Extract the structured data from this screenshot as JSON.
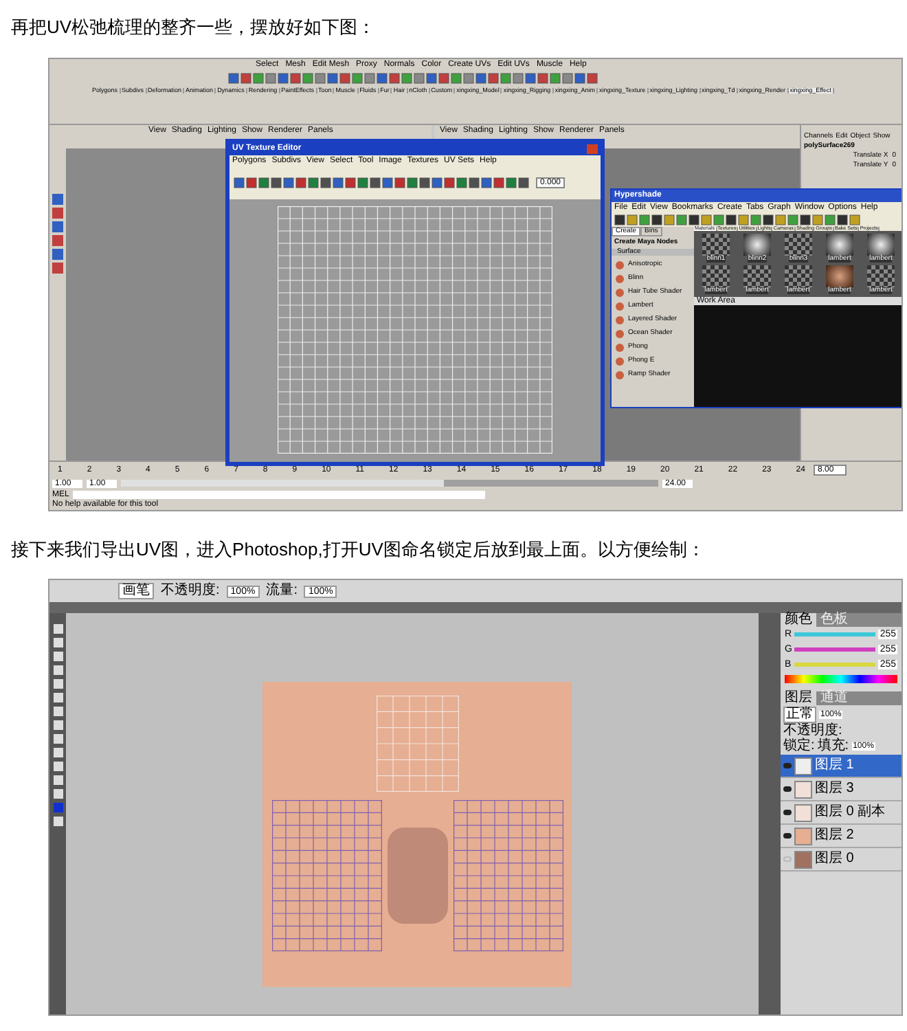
{
  "intro_text": "再把UV松弛梳理的整齐一些，摆放好如下图：",
  "maya_screenshot": {
    "menus": [
      "Select",
      "Mesh",
      "Edit Mesh",
      "Proxy",
      "Normals",
      "Color",
      "Create UVs",
      "Edit UVs",
      "Muscle",
      "Help"
    ],
    "shelf_tabs": [
      {
        "label": "Polygons",
        "selected": false
      },
      {
        "label": "Subdivs",
        "selected": false
      },
      {
        "label": "Deformation",
        "selected": false
      },
      {
        "label": "Animation",
        "selected": false
      },
      {
        "label": "Dynamics",
        "selected": false
      },
      {
        "label": "Rendering",
        "selected": false
      },
      {
        "label": "PaintEffects",
        "selected": false
      },
      {
        "label": "Toon",
        "selected": false
      },
      {
        "label": "Muscle",
        "selected": false
      },
      {
        "label": "Fluids",
        "selected": false
      },
      {
        "label": "Fur",
        "selected": false
      },
      {
        "label": "Hair",
        "selected": false
      },
      {
        "label": "nCloth",
        "selected": false
      },
      {
        "label": "Custom",
        "selected": false
      },
      {
        "label": "xingxing_Model",
        "selected": false
      },
      {
        "label": "xingxing_Rigging",
        "selected": false
      },
      {
        "label": "xingxing_Anim",
        "selected": false
      },
      {
        "label": "xingxing_Texture",
        "selected": false
      },
      {
        "label": "xingxing_Lighting",
        "selected": false
      },
      {
        "label": "xingxing_Td",
        "selected": false
      },
      {
        "label": "xingxing_Render",
        "selected": false
      },
      {
        "label": "xingxing_Effect",
        "selected": true
      }
    ],
    "viewports": [
      {
        "menus": [
          "View",
          "Shading",
          "Lighting",
          "Show",
          "Renderer",
          "Panels"
        ]
      },
      {
        "menus": [
          "View",
          "Shading",
          "Lighting",
          "Show",
          "Renderer",
          "Panels"
        ]
      }
    ],
    "channel_box": {
      "menus": [
        "Channels",
        "Edit",
        "Object",
        "Show"
      ],
      "object": "polySurface269",
      "attributes": [
        {
          "name": "Translate X",
          "value": "0"
        },
        {
          "name": "Translate Y",
          "value": "0"
        }
      ]
    },
    "uv_editor": {
      "title": "UV Texture Editor",
      "menus": [
        "Polygons",
        "Subdivs",
        "View",
        "Select",
        "Tool",
        "Image",
        "Textures",
        "UV Sets",
        "Help"
      ],
      "field_value": "0.000"
    },
    "hypershade": {
      "title": "Hypershade",
      "menus": [
        "File",
        "Edit",
        "View",
        "Bookmarks",
        "Create",
        "Tabs",
        "Graph",
        "Window",
        "Options",
        "Help"
      ],
      "side_tabs": [
        {
          "label": "Create",
          "selected": true
        },
        {
          "label": "Bins",
          "selected": false
        }
      ],
      "nodes_heading": "Create Maya Nodes",
      "group": "Surface",
      "nodes": [
        "Anisotropic",
        "Blinn",
        "Hair Tube Shader",
        "Lambert",
        "Layered Shader",
        "Ocean Shader",
        "Phong",
        "Phong E",
        "Ramp Shader"
      ],
      "tabs": [
        {
          "label": "Materials",
          "selected": true
        },
        {
          "label": "Textures",
          "selected": false
        },
        {
          "label": "Utilities",
          "selected": false
        },
        {
          "label": "Lights",
          "selected": false
        },
        {
          "label": "Cameras",
          "selected": false
        },
        {
          "label": "Shading Groups",
          "selected": false
        },
        {
          "label": "Bake Sets",
          "selected": false
        },
        {
          "label": "Projects",
          "selected": false
        }
      ],
      "swatches": [
        {
          "label": "blinn1",
          "kind": "checker"
        },
        {
          "label": "blinn2",
          "kind": "sphere"
        },
        {
          "label": "blinn3",
          "kind": "checker"
        },
        {
          "label": "lambert",
          "kind": "sphere"
        },
        {
          "label": "lambert",
          "kind": "sphere"
        },
        {
          "label": "lambert",
          "kind": "checker"
        },
        {
          "label": "lambert",
          "kind": "checker"
        },
        {
          "label": "lambert",
          "kind": "checker"
        },
        {
          "label": "lambert",
          "kind": "skin"
        },
        {
          "label": "lambert",
          "kind": "checker"
        }
      ],
      "work_area": "Work Area"
    },
    "timeline": [
      "1",
      "2",
      "3",
      "4",
      "5",
      "6",
      "7",
      "8",
      "9",
      "10",
      "11",
      "12",
      "13",
      "14",
      "15",
      "16",
      "17",
      "18",
      "19",
      "20",
      "21",
      "22",
      "23",
      "24"
    ],
    "current_time": "8.00",
    "range": {
      "level": 0.6
    },
    "range_start": "1.00",
    "range_current": "1.00",
    "range_end": "24.00",
    "command_label": "MEL",
    "help_line": "No help available for this tool"
  },
  "export_text": "接下来我们导出UV图，进入Photoshop,打开UV图命名锁定后放到最上面。以方便绘制：",
  "photoshop_screenshot": {
    "options": {
      "tool": "画笔",
      "opacity_label": "不透明度:",
      "opacity": "100%",
      "flow_label": "流量:",
      "flow": "100%"
    },
    "color_panel": {
      "tabs": [
        {
          "label": "颜色",
          "selected": true
        },
        {
          "label": "色板",
          "selected": false
        }
      ],
      "channels": [
        {
          "name": "R",
          "value": "255",
          "level": 1,
          "color": "#3cc8d8"
        },
        {
          "name": "G",
          "value": "255",
          "level": 1,
          "color": "#d040c0"
        },
        {
          "name": "B",
          "value": "255",
          "level": 1,
          "color": "#d8d840"
        }
      ]
    },
    "layers_panel": {
      "tabs": [
        {
          "label": "图层",
          "selected": true
        },
        {
          "label": "通道",
          "selected": false
        }
      ],
      "blend_mode": "正常",
      "opacity_label": "不透明度:",
      "opacity": "100%",
      "lock_label": "锁定:",
      "fill_label": "填充:",
      "fill": "100%",
      "layers": [
        {
          "name": "图层 1",
          "visible": true,
          "selected": true,
          "kind": "grid"
        },
        {
          "name": "图层 3",
          "visible": true,
          "selected": false,
          "kind": "sketch"
        },
        {
          "name": "图层 0 副本",
          "visible": true,
          "selected": false,
          "kind": "sketch"
        },
        {
          "name": "图层 2",
          "visible": true,
          "selected": false,
          "kind": "fill"
        },
        {
          "name": "图层 0",
          "visible": false,
          "selected": false,
          "kind": "photo"
        }
      ]
    }
  }
}
